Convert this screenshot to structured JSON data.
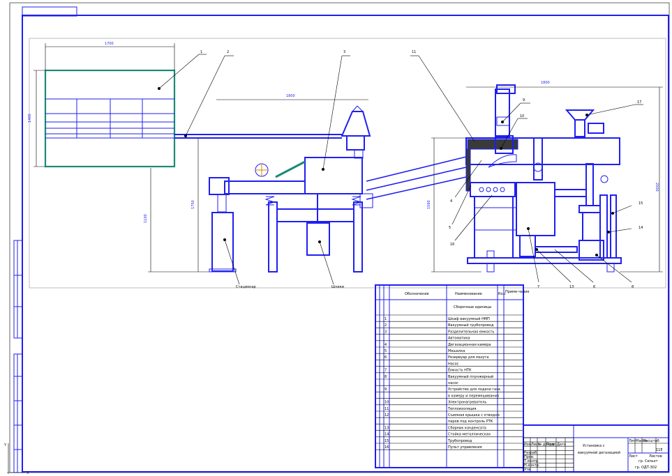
{
  "drawing": {
    "title_line_1": "Установка с",
    "title_line_2": "вакуумной дегазацией",
    "sheet_code": "11Е",
    "organization_line_1": "гр. Сельхт",
    "organization_line_2": "гр. ОДТ-302"
  },
  "callouts": [
    "1",
    "2",
    "3",
    "11",
    "9",
    "10",
    "17",
    "4",
    "5",
    "16",
    "15",
    "14",
    "7",
    "13",
    "6",
    "8"
  ],
  "bottom_labels": {
    "left": "Стационар",
    "middle": "Шнеки"
  },
  "dimensions": {
    "top_left": "1700",
    "left_height": "1400",
    "middle_top": "1800",
    "middle_left": "1750",
    "low_left": "1100",
    "right_top": "1800",
    "right_height": "2000",
    "right_left": "1560"
  },
  "spec": {
    "headers": [
      "Обозначение",
      "Наименование",
      "Кол.",
      "Приме-чание"
    ],
    "section": "Сборочные единицы",
    "rows": [
      {
        "pos": "1",
        "name": "Шкаф вакуумный НМП"
      },
      {
        "pos": "2",
        "name": "Вакуумный трубопровод"
      },
      {
        "pos": "3",
        "name": "Разделительная емкость"
      },
      {
        "pos": "",
        "name": "Автоматика"
      },
      {
        "pos": "4",
        "name": "Дегазационная камера"
      },
      {
        "pos": "5",
        "name": "Мешалка"
      },
      {
        "pos": "6",
        "name": "Резервуар для мазута"
      },
      {
        "pos": "",
        "name": "Насос"
      },
      {
        "pos": "7",
        "name": "Ёмкость НТК"
      },
      {
        "pos": "8",
        "name": "Вакуумный плунжерный"
      },
      {
        "pos": "",
        "name": "насос"
      },
      {
        "pos": "9",
        "name": "Устройство для подачи газа"
      },
      {
        "pos": "",
        "name": "в камеру и перемешивания"
      },
      {
        "pos": "10",
        "name": "Электронагреватель"
      },
      {
        "pos": "11",
        "name": "Теплоизоляция"
      },
      {
        "pos": "12",
        "name": "Съемная крышка с отводом"
      },
      {
        "pos": "",
        "name": "паров под контроль РТК"
      },
      {
        "pos": "13",
        "name": "Сборник конденсата"
      },
      {
        "pos": "14",
        "name": "Стойка металлическая"
      },
      {
        "pos": "15",
        "name": "Трубопровод"
      },
      {
        "pos": "16",
        "name": "Пульт управления"
      }
    ]
  },
  "stamp_labels": [
    "Изм.",
    "Лист",
    "№ докум.",
    "Подп.",
    "Дата",
    "Разраб.",
    "Пров.",
    "Т.контр.",
    "Н.контр.",
    "Утв.",
    "Лит.",
    "Масса",
    "Масштаб",
    "Лист",
    "Листов"
  ]
}
